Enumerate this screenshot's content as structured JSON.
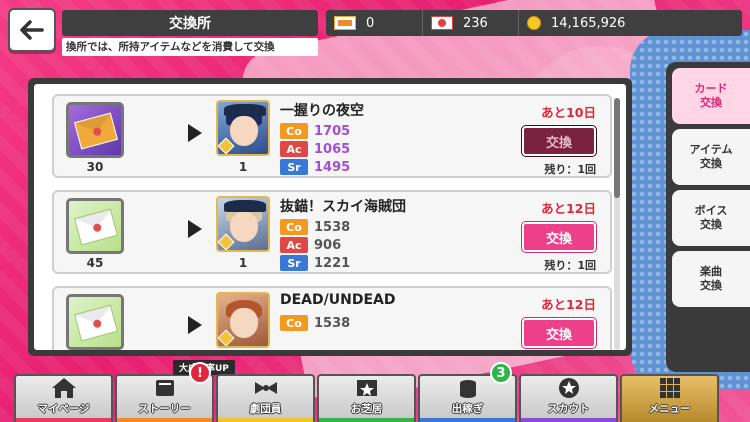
{
  "header": {
    "title": "交換所",
    "subtitle": "換所では、所持アイテムなどを消費して交換"
  },
  "currency": [
    {
      "icon": "ticket-icon",
      "value": "0"
    },
    {
      "icon": "red-ticket-icon",
      "value": "236"
    },
    {
      "icon": "coin-icon",
      "value": "14,165,926"
    }
  ],
  "items": [
    {
      "cost_qty": "30",
      "card_qty": "1",
      "name": "一握りの夜空",
      "deadline": "あと10日",
      "stats": {
        "co": "1705",
        "ac": "1065",
        "sr": "1495"
      },
      "labels": {
        "co": "Co",
        "ac": "Ac",
        "sr": "Sr"
      },
      "button": "交換",
      "remain": "残り：1回"
    },
    {
      "cost_qty": "45",
      "card_qty": "1",
      "name": "抜錨！スカイ海賊団",
      "deadline": "あと12日",
      "stats": {
        "co": "1538",
        "ac": "906",
        "sr": "1221"
      },
      "labels": {
        "co": "Co",
        "ac": "Ac",
        "sr": "Sr"
      },
      "button": "交換",
      "remain": "残り：1回"
    },
    {
      "name": "DEAD/UNDEAD",
      "deadline": "あと12日",
      "stats": {
        "co": "1538"
      },
      "labels": {
        "co": "Co"
      },
      "button": "交換"
    }
  ],
  "tabs": [
    {
      "label": "カード\n交換",
      "line1": "カード",
      "line2": "交換"
    },
    {
      "label": "アイテム交換",
      "line1": "アイテム",
      "line2": "交換"
    },
    {
      "label": "ボイス交換",
      "line1": "ボイス",
      "line2": "交換"
    },
    {
      "label": "楽曲交換",
      "line1": "楽曲",
      "line2": "交換"
    }
  ],
  "nav": [
    {
      "label": "マイページ",
      "icon": "home-icon",
      "color": "#e63a5e"
    },
    {
      "label": "ストーリー",
      "icon": "book-icon",
      "color": "#f08a2a",
      "badge": "!",
      "up": "大成功率UP"
    },
    {
      "label": "劇団員",
      "icon": "bowtie-icon",
      "color": "#f3c22a"
    },
    {
      "label": "お芝居",
      "icon": "stage-icon",
      "color": "#38b24a"
    },
    {
      "label": "出稼ぎ",
      "icon": "coins-icon",
      "color": "#3a78d6",
      "badge": "3"
    },
    {
      "label": "スカウト",
      "icon": "star-badge-icon",
      "color": "#8e4ad1"
    },
    {
      "label": "メニュー",
      "icon": "grid-icon",
      "color": "#b68a2c"
    }
  ]
}
